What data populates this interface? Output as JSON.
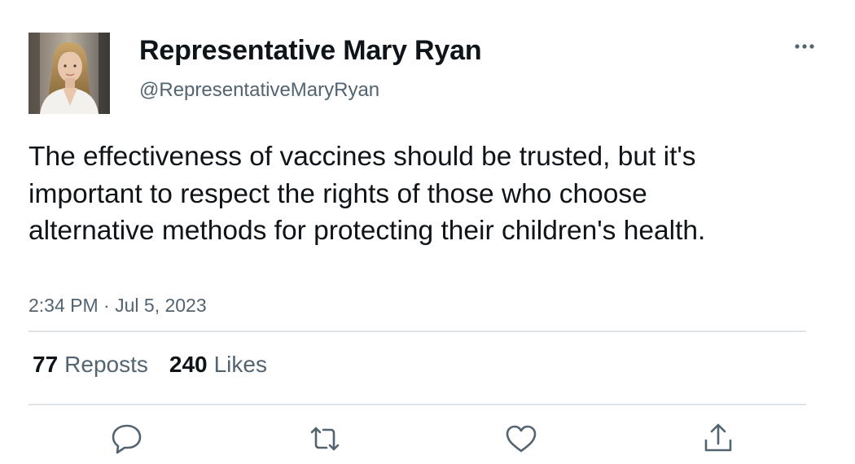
{
  "author": {
    "display_name": "Representative Mary Ryan",
    "handle": "@RepresentativeMaryRyan",
    "avatar_icon": "profile-photo"
  },
  "tweet": {
    "text": "The effectiveness of vaccines should be trusted, but it's important to respect the rights of those who choose alternative methods for protecting their children's health.",
    "time": "2:34 PM",
    "separator": " · ",
    "date": "Jul 5, 2023"
  },
  "stats": {
    "reposts_count": "77",
    "reposts_label": "Reposts",
    "likes_count": "240",
    "likes_label": "Likes"
  },
  "actions": {
    "icons": [
      "reply-icon",
      "retweet-icon",
      "like-icon",
      "share-icon"
    ]
  },
  "colors": {
    "text_primary": "#0f1419",
    "text_secondary": "#536471",
    "divider": "#dfe3e6",
    "icon": "#536471"
  }
}
